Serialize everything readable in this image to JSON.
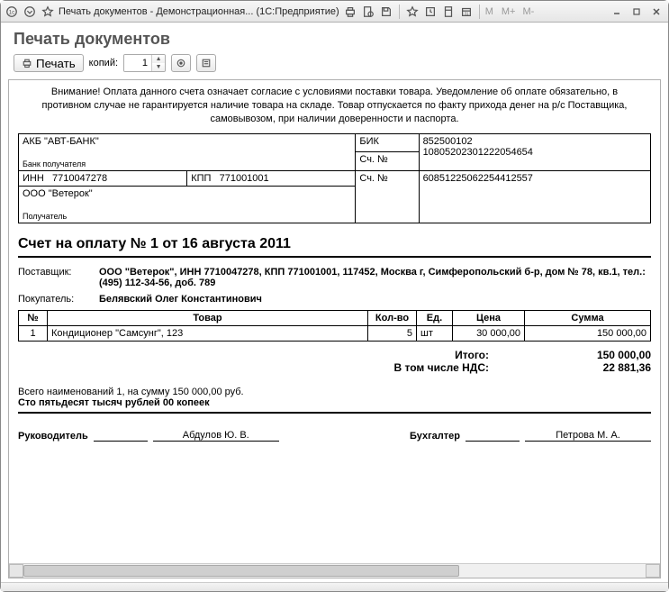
{
  "window": {
    "title": "Печать документов - Демонстрационная...   (1С:Предприятие)",
    "mem_labels": {
      "m": "M",
      "mplus": "M+",
      "mminus": "M-"
    }
  },
  "header": {
    "title": "Печать документов"
  },
  "toolbar": {
    "print_label": "Печать",
    "copies_label": "копий:",
    "copies_value": "1"
  },
  "doc": {
    "notice": "Внимание! Оплата данного счета означает согласие с условиями поставки товара. Уведомление об оплате обязательно, в противном случае не гарантируется наличие товара на складе. Товар отпускается по факту прихода денег на р/с Поставщика, самовывозом, при наличии доверенности и паспорта.",
    "bank": {
      "bank_name": "АКБ \"АВТ-БАНК\"",
      "bank_recipient_label": "Банк получателя",
      "inn_label": "ИНН",
      "inn": "7710047278",
      "kpp_label": "КПП",
      "kpp": "771001001",
      "recipient_name": "ООО \"Ветерок\"",
      "recipient_label": "Получатель",
      "bik_label": "БИК",
      "bik": "852500102",
      "account_label": "Сч. №",
      "corr_account": "10805202301222054654",
      "account_label2": "Сч. №",
      "account": "60851225062254412557"
    },
    "title": "Счет на оплату № 1 от 16 августа 2011",
    "supplier_label": "Поставщик:",
    "supplier": "ООО \"Ветерок\", ИНН 7710047278, КПП 771001001, 117452, Москва г, Симферопольский б-р, дом № 78, кв.1, тел.: (495) 112-34-56, доб. 789",
    "buyer_label": "Покупатель:",
    "buyer": "Белявский Олег Константинович",
    "items_header": {
      "num": "№",
      "name": "Товар",
      "qty": "Кол-во",
      "unit": "Ед.",
      "price": "Цена",
      "sum": "Сумма"
    },
    "items": [
      {
        "num": "1",
        "name": "Кондиционер \"Самсунг\", 123",
        "qty": "5",
        "unit": "шт",
        "price": "30 000,00",
        "sum": "150 000,00"
      }
    ],
    "totals": {
      "total_label": "Итого:",
      "total": "150 000,00",
      "vat_label": "В том числе НДС:",
      "vat": "22 881,36"
    },
    "summary_line": "Всего наименований 1, на сумму 150 000,00 руб.",
    "summary_words": "Сто пятьдесят тысяч рублей 00 копеек",
    "sign": {
      "director_label": "Руководитель",
      "director": "Абдулов Ю. В.",
      "accountant_label": "Бухгалтер",
      "accountant": "Петрова М. А."
    }
  }
}
